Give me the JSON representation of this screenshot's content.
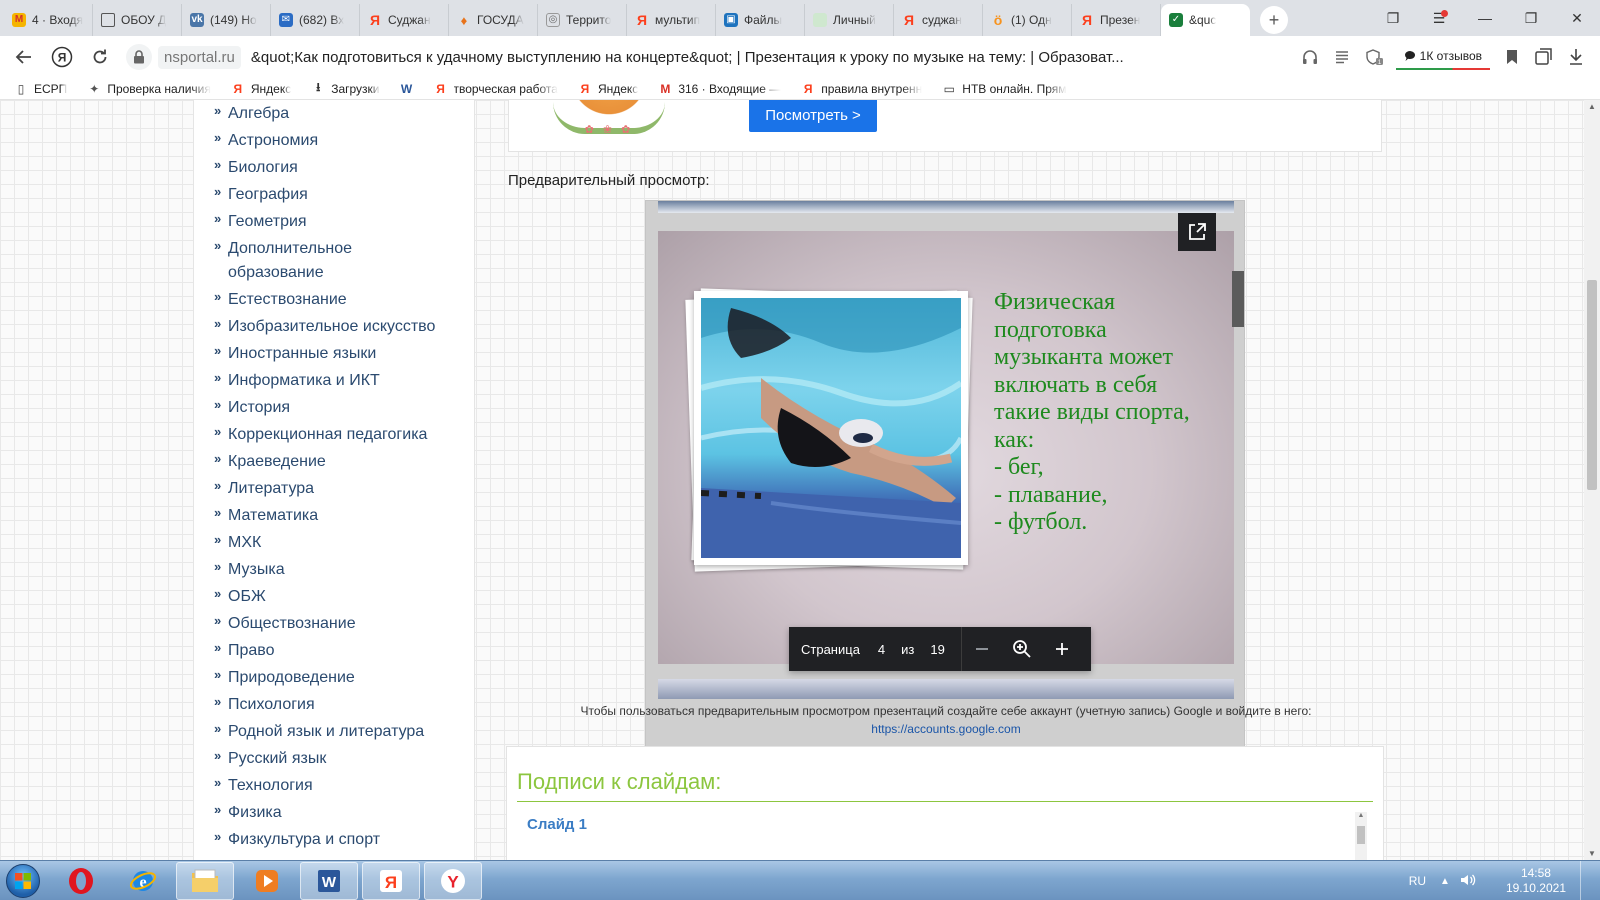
{
  "tabs": [
    {
      "label": "4 · Входя",
      "icon": "gmail-icon"
    },
    {
      "label": "ОБОУ Д",
      "icon": "document-icon"
    },
    {
      "label": "(149) Но",
      "icon": "vk-icon"
    },
    {
      "label": "(682) Вх",
      "icon": "mail-icon"
    },
    {
      "label": "Суджан",
      "icon": "yandex-icon"
    },
    {
      "label": "ГОСУДА",
      "icon": "gos-icon"
    },
    {
      "label": "Террито",
      "icon": "territory-icon"
    },
    {
      "label": "мультип",
      "icon": "yandex-icon"
    },
    {
      "label": "Файлы",
      "icon": "files-icon"
    },
    {
      "label": "Личный",
      "icon": "cabinet-icon"
    },
    {
      "label": "суджан",
      "icon": "yandex-icon"
    },
    {
      "label": "(1) Одн",
      "icon": "ok-icon"
    },
    {
      "label": "Презен",
      "icon": "yandex-icon"
    },
    {
      "label": "&quc",
      "icon": "nsportal-icon",
      "active": true
    }
  ],
  "address": {
    "domain": "nsportal.ru",
    "title": "&quot;Как подготовиться к удачному выступлению на концерте&quot; | Презентация к уроку по музыке на тему: | Образоват...",
    "reviews_label": "1К отзывов"
  },
  "bookmarks": [
    {
      "label": "ЕСРП",
      "icon": "page-icon"
    },
    {
      "label": "Проверка наличия",
      "icon": "eagle-icon"
    },
    {
      "label": "Яндекс",
      "icon": "yandex-icon"
    },
    {
      "label": "Загрузки",
      "icon": "download-icon"
    },
    {
      "label": "",
      "icon": "word-icon"
    },
    {
      "label": "творческая работа",
      "icon": "yandex-icon"
    },
    {
      "label": "Яндекс",
      "icon": "yandex-icon"
    },
    {
      "label": "316 · Входящие —",
      "icon": "gmail-icon"
    },
    {
      "label": "правила внутренн",
      "icon": "yandex-icon"
    },
    {
      "label": "НТВ онлайн. Прям",
      "icon": "monitor-icon"
    }
  ],
  "sidebar": {
    "subjects": [
      [
        "Алгебра"
      ],
      [
        "Астрономия"
      ],
      [
        "Биология"
      ],
      [
        "География"
      ],
      [
        "Геометрия"
      ],
      [
        "Дополнительное",
        "образование"
      ],
      [
        "Естествознание"
      ],
      [
        "Изобразительное искусство"
      ],
      [
        "Иностранные языки"
      ],
      [
        "Информатика и ИКТ"
      ],
      [
        "История"
      ],
      [
        "Коррекционная педагогика"
      ],
      [
        "Краеведение"
      ],
      [
        "Литература"
      ],
      [
        "Математика"
      ],
      [
        "МХК"
      ],
      [
        "Музыка"
      ],
      [
        "ОБЖ"
      ],
      [
        "Обществознание"
      ],
      [
        "Право"
      ],
      [
        "Природоведение"
      ],
      [
        "Психология"
      ],
      [
        "Родной язык и литература"
      ],
      [
        "Русский язык"
      ],
      [
        "Технология"
      ],
      [
        "Физика"
      ],
      [
        "Физкультура и спорт"
      ]
    ]
  },
  "promo": {
    "button_label": "Посмотреть >"
  },
  "preview": {
    "label": "Предварительный просмотр:",
    "slide_text_lines": [
      "Физическая",
      "подготовка",
      "музыканта может",
      "включать в себя",
      "такие виды спорта,",
      "как:",
      "- бег,",
      "- плавание,",
      "- футбол."
    ],
    "pager": {
      "page_label": "Страница",
      "current_page": "4",
      "of_label": "из",
      "total_pages": "19"
    }
  },
  "notice": {
    "text": "Чтобы пользоваться предварительным просмотром презентаций создайте себе аккаунт (учетную запись) Google и войдите в него:",
    "link": "https://accounts.google.com"
  },
  "captions": {
    "title": "Подписи к слайдам:",
    "first_slide": "Слайд 1"
  },
  "taskbar": {
    "lang": "RU",
    "time": "14:58",
    "date": "19.10.2021"
  },
  "colors": {
    "accent_blue": "#1a73e8",
    "subject_link": "#2b4a6f",
    "slide_text_green": "#1e8a1e",
    "captions_green": "#8cc63f"
  }
}
